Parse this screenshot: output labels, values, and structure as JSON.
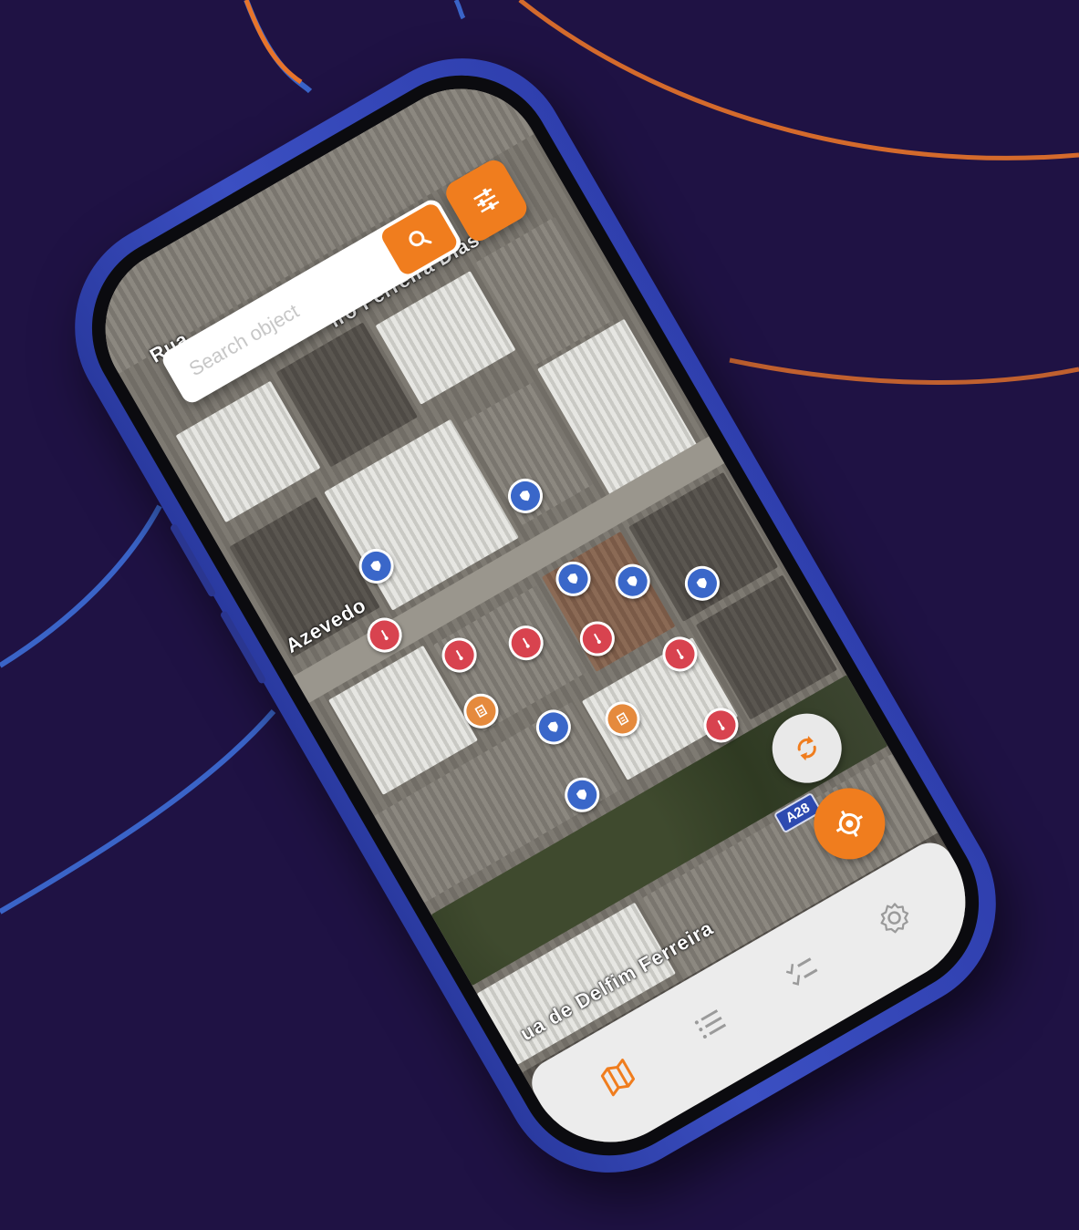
{
  "search": {
    "placeholder": "Search object"
  },
  "map": {
    "street_labels": [
      "Rua",
      "iro Ferreira Dias",
      "Azevedo",
      "ua de Delfim Ferreira"
    ],
    "road_badge": "A28"
  },
  "markers": [
    {
      "color": "blue",
      "icon": "shield-icon"
    },
    {
      "color": "red",
      "icon": "thermometer-icon"
    },
    {
      "color": "red",
      "icon": "thermometer-icon"
    },
    {
      "color": "blue",
      "icon": "shield-icon"
    },
    {
      "color": "orange",
      "icon": "document-icon"
    },
    {
      "color": "red",
      "icon": "thermometer-icon"
    },
    {
      "color": "blue",
      "icon": "shield-icon"
    },
    {
      "color": "blue",
      "icon": "shield-icon"
    },
    {
      "color": "red",
      "icon": "thermometer-icon"
    },
    {
      "color": "blue",
      "icon": "shield-icon"
    },
    {
      "color": "blue",
      "icon": "shield-icon"
    },
    {
      "color": "red",
      "icon": "thermometer-icon"
    },
    {
      "color": "orange",
      "icon": "document-icon"
    },
    {
      "color": "blue",
      "icon": "shield-icon"
    },
    {
      "color": "red",
      "icon": "thermometer-icon"
    }
  ],
  "bottom_nav": {
    "items": [
      {
        "icon": "map-icon",
        "active": true
      },
      {
        "icon": "list-icon",
        "active": false
      },
      {
        "icon": "checklist-icon",
        "active": false
      },
      {
        "icon": "gear-icon",
        "active": false
      }
    ]
  },
  "colors": {
    "background": "#1f1244",
    "accent": "#f07d1e",
    "phone_frame": "#3b4fc2",
    "marker_blue": "#3a67c9",
    "marker_red": "#d8434f",
    "marker_orange": "#e58a3d"
  }
}
